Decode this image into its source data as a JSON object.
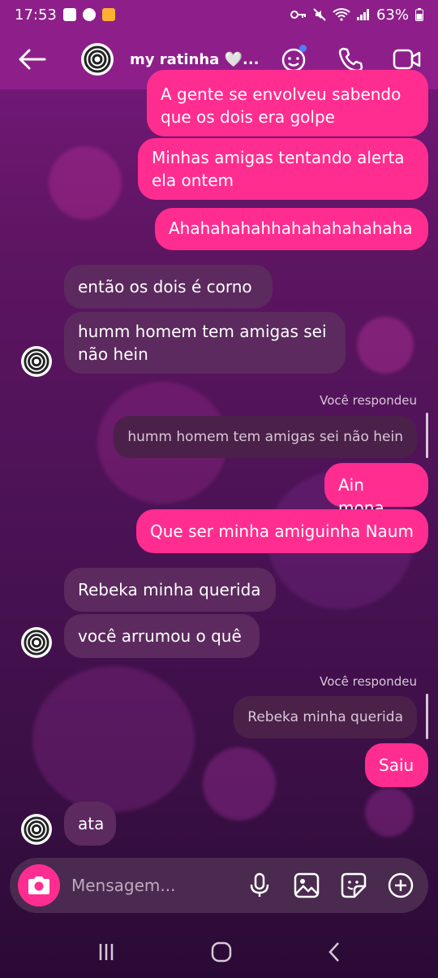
{
  "status_bar": {
    "time": "17:53",
    "battery": "63%"
  },
  "header": {
    "contact_name": "my ratinha 🤍..."
  },
  "messages": {
    "m1": "A gente se envolveu sabendo que os dois era golpe",
    "m2": "Minhas amigas tentando alerta ela ontem",
    "m3": "Ahahahahahhahahahahahaha",
    "m4": "então os dois é corno",
    "m5": "humm homem tem amigas sei não hein",
    "reply1_label": "Você respondeu",
    "reply1_quote": "humm homem tem amigas sei não hein",
    "m6": "Ain mona",
    "m7": "Que ser minha amiguinha Naum",
    "m8": "Rebeka minha querida",
    "m9": "você arrumou o quê",
    "reply2_label": "Você respondeu",
    "reply2_quote": "Rebeka minha querida",
    "m10": "Saiu",
    "m11": "ata"
  },
  "composer": {
    "placeholder": "Mensagem..."
  },
  "colors": {
    "outgoing": "#ff2d8f",
    "incoming": "#5c2a5e",
    "header": "#8e1f8a"
  }
}
